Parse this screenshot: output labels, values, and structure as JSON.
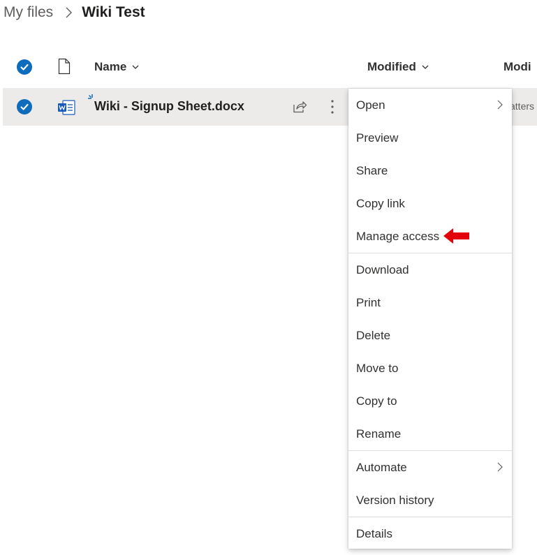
{
  "breadcrumb": {
    "root": "My files",
    "current": "Wiki Test"
  },
  "columns": {
    "name": "Name",
    "modified": "Modified",
    "modified_by_partial": "Modi"
  },
  "file": {
    "name": "Wiki - Signup Sheet.docx",
    "partial_text": "atters"
  },
  "menu": {
    "groups": [
      [
        {
          "label": "Open",
          "submenu": true
        },
        {
          "label": "Preview"
        },
        {
          "label": "Share"
        },
        {
          "label": "Copy link"
        },
        {
          "label": "Manage access",
          "highlighted": true
        }
      ],
      [
        {
          "label": "Download"
        },
        {
          "label": "Print"
        },
        {
          "label": "Delete"
        },
        {
          "label": "Move to"
        },
        {
          "label": "Copy to"
        },
        {
          "label": "Rename"
        }
      ],
      [
        {
          "label": "Automate",
          "submenu": true
        },
        {
          "label": "Version history"
        }
      ],
      [
        {
          "label": "Details"
        }
      ]
    ]
  },
  "icons": {
    "breadcrumb_separator": "chevron-right-icon",
    "header_check": "checkmark-circle-icon",
    "file_type_header": "document-icon",
    "row_check": "checkmark-circle-icon",
    "file_icon": "word-document-icon",
    "new_indicator": "new-sparkle-icon",
    "share": "share-icon",
    "more": "more-vertical-icon",
    "submenu": "chevron-right-icon",
    "annotation": "red-arrow-icon"
  },
  "colors": {
    "accent": "#0f6cbd",
    "word": "#185abd",
    "row_selected": "#edebe9",
    "annotation_arrow": "#e3000b"
  }
}
